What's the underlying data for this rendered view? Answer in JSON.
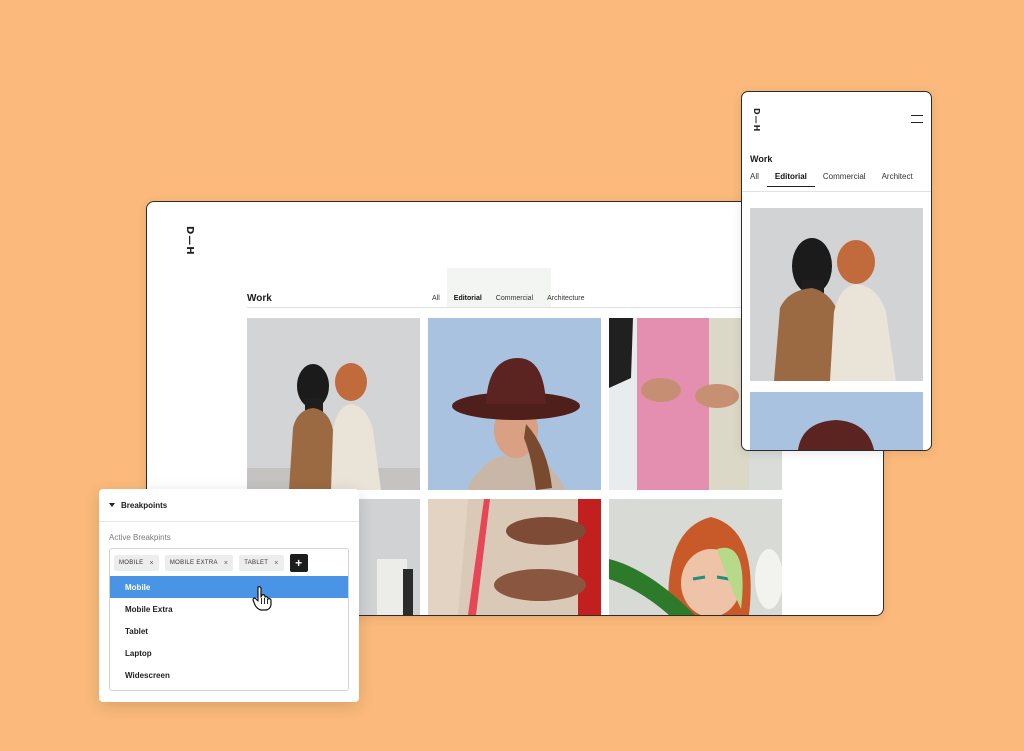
{
  "desktop": {
    "logo": "D—H",
    "title": "Work",
    "tabs": [
      "All",
      "Editorial",
      "Commercial",
      "Architecture"
    ],
    "active_tab": "Editorial"
  },
  "mobile": {
    "logo": "D—H",
    "title": "Work",
    "tabs": [
      "All",
      "Editorial",
      "Commercial",
      "Architect"
    ],
    "active_tab": "Editorial"
  },
  "breakpoints": {
    "header": "Breakpoints",
    "subheading": "Active Breakpints",
    "chips": [
      "MOBILE",
      "MOBILE EXTRA",
      "TABLET"
    ],
    "remove_glyph": "×",
    "add_glyph": "+",
    "options": [
      "Mobile",
      "Mobile Extra",
      "Tablet",
      "Laptop",
      "Widescreen"
    ],
    "highlighted_option": "Mobile"
  },
  "colors": {
    "background": "#fbba7b",
    "highlight": "#4a94e6",
    "add_button": "#1d1d1d"
  },
  "icons": [
    "menu-icon",
    "caret-down-icon",
    "close-icon",
    "plus-icon",
    "hand-pointer-icon"
  ]
}
